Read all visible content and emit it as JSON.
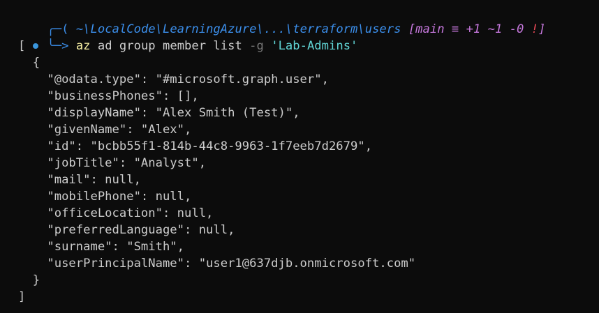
{
  "prompt": {
    "path": "~\\LocalCode\\LearningAzure\\...\\terraform\\users",
    "git_status": "[main ≡ +1 ~1 -0 ",
    "git_bang": "!",
    "git_close": "]",
    "command_name": "az",
    "command_args": " ad group member list ",
    "command_flag": "-g",
    "command_value": " 'Lab-Admins'"
  },
  "output": {
    "lines": [
      "[",
      "  {",
      "    \"@odata.type\": \"#microsoft.graph.user\",",
      "    \"businessPhones\": [],",
      "    \"displayName\": \"Alex Smith (Test)\",",
      "    \"givenName\": \"Alex\",",
      "    \"id\": \"bcbb55f1-814b-44c8-9963-1f7eeb7d2679\",",
      "    \"jobTitle\": \"Analyst\",",
      "    \"mail\": null,",
      "    \"mobilePhone\": null,",
      "    \"officeLocation\": null,",
      "    \"preferredLanguage\": null,",
      "    \"surname\": \"Smith\",",
      "    \"userPrincipalName\": \"user1@637djb.onmicrosoft.com\"",
      "  }",
      "]"
    ]
  },
  "colors": {
    "background": "#0c0c0c",
    "path": "#3b8eea",
    "git": "#c678dd",
    "command": "#f9f1a5",
    "string_arg": "#61d6d6",
    "text": "#cccccc"
  }
}
